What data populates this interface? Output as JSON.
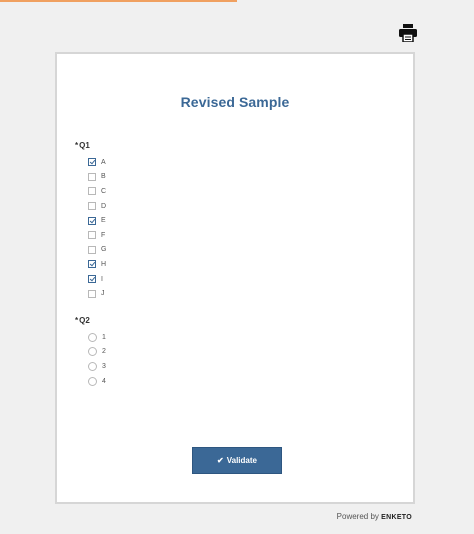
{
  "form": {
    "title": "Revised Sample"
  },
  "q1": {
    "required_mark": "*",
    "label": "Q1",
    "options": [
      {
        "label": "A",
        "checked": true
      },
      {
        "label": "B",
        "checked": false
      },
      {
        "label": "C",
        "checked": false
      },
      {
        "label": "D",
        "checked": false
      },
      {
        "label": "E",
        "checked": true
      },
      {
        "label": "F",
        "checked": false
      },
      {
        "label": "G",
        "checked": false
      },
      {
        "label": "H",
        "checked": true
      },
      {
        "label": "I",
        "checked": true
      },
      {
        "label": "J",
        "checked": false
      }
    ]
  },
  "q2": {
    "required_mark": "*",
    "label": "Q2",
    "options": [
      {
        "label": "1",
        "selected": false
      },
      {
        "label": "2",
        "selected": false
      },
      {
        "label": "3",
        "selected": false
      },
      {
        "label": "4",
        "selected": false
      }
    ]
  },
  "actions": {
    "validate_label": "Validate",
    "validate_icon": "check-icon"
  },
  "footer": {
    "powered_by": "Powered by",
    "brand": "ENKETO"
  },
  "toolbar": {
    "print_icon": "print-icon"
  },
  "colors": {
    "accent": "#3b6896",
    "progress": "#f0a060"
  }
}
